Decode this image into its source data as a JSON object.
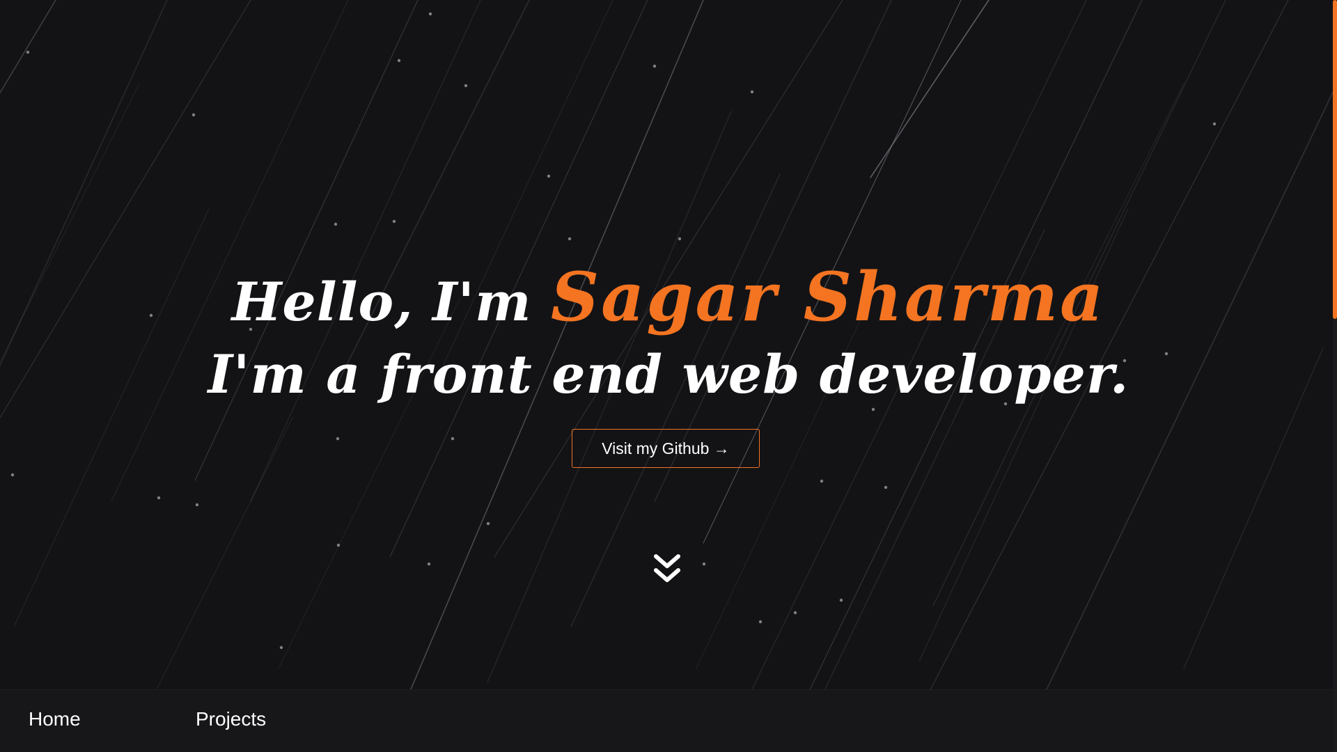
{
  "hero": {
    "greeting": "Hello, I'm",
    "name": "Sagar Sharma",
    "tagline": "I'm a front end web developer.",
    "cta_label": "Visit my Github →",
    "scroll_icon": "double-chevron-down-icon"
  },
  "nav": {
    "items": [
      {
        "label": "Home"
      },
      {
        "label": "Projects"
      }
    ]
  },
  "colors": {
    "background": "#131316",
    "accent": "#f47421",
    "text": "#ffffff",
    "streak": "#4a4a50"
  }
}
